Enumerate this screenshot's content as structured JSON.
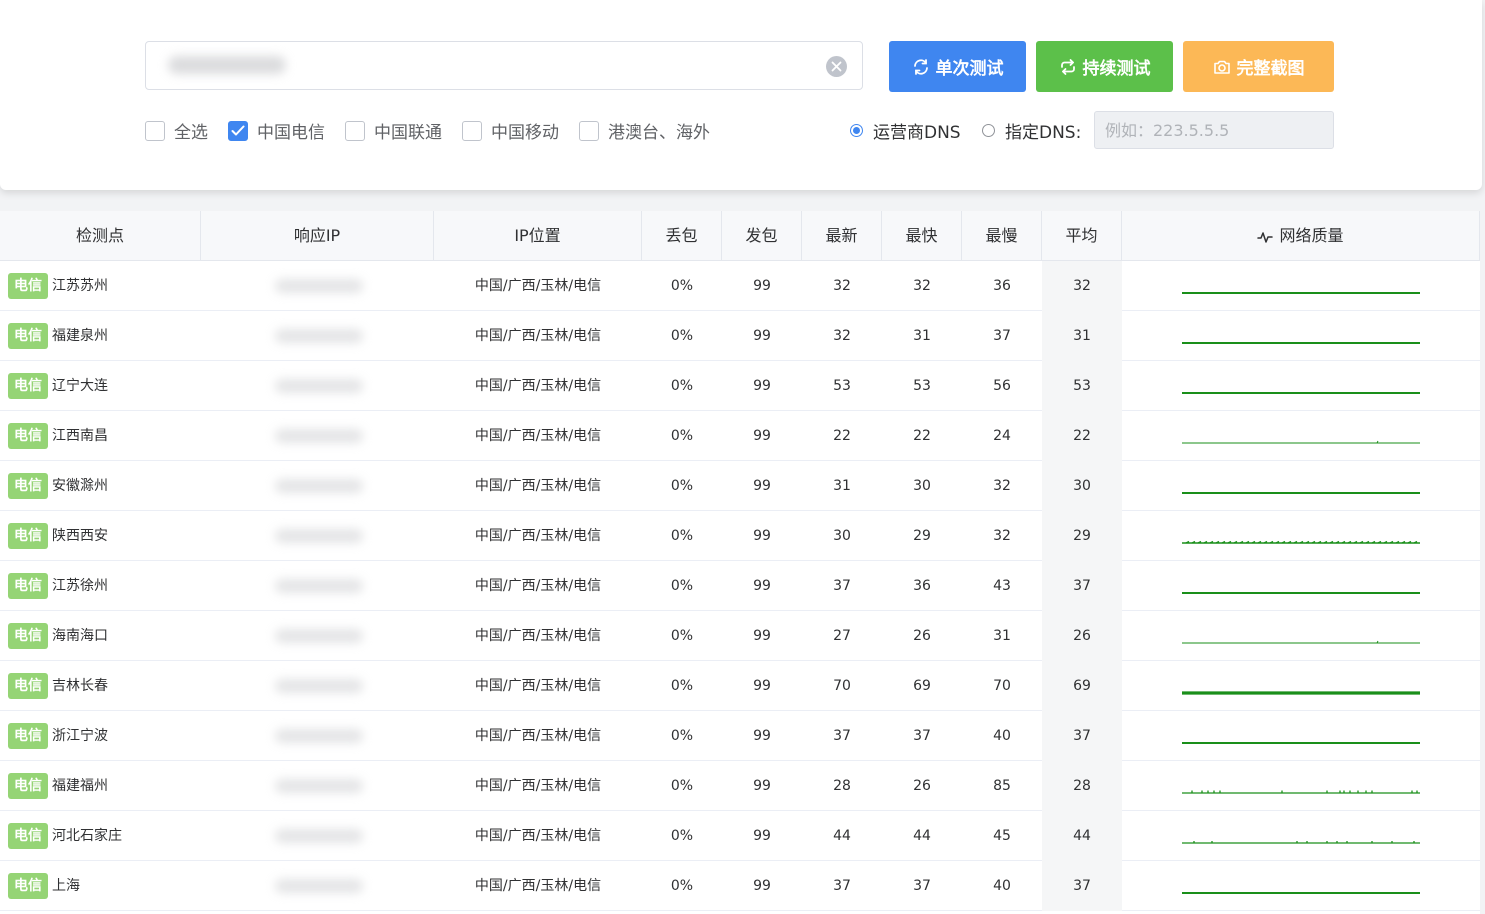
{
  "search": {
    "placeholder": "",
    "value": ""
  },
  "buttons": {
    "single": "单次测试",
    "continuous": "持续测试",
    "screenshot": "完整截图"
  },
  "filters": [
    {
      "label": "全选",
      "checked": false
    },
    {
      "label": "中国电信",
      "checked": true
    },
    {
      "label": "中国联通",
      "checked": false
    },
    {
      "label": "中国移动",
      "checked": false
    },
    {
      "label": "港澳台、海外",
      "checked": false
    }
  ],
  "dns": {
    "carrier_label": "运营商DNS",
    "custom_label": "指定DNS:",
    "custom_placeholder": "例如：223.5.5.5",
    "selected": "carrier"
  },
  "table": {
    "headers": {
      "node": "检测点",
      "ip": "响应IP",
      "location": "IP位置",
      "loss": "丢包",
      "sent": "发包",
      "latest": "最新",
      "fastest": "最快",
      "slowest": "最慢",
      "average": "平均",
      "quality": "网络质量"
    },
    "rows": [
      {
        "isp": "电信",
        "node": "江苏苏州",
        "location": "中国/广西/玉林/电信",
        "loss": "0%",
        "sent": "99",
        "latest": "32",
        "fastest": "32",
        "slowest": "36",
        "average": "32",
        "spark": "flat"
      },
      {
        "isp": "电信",
        "node": "福建泉州",
        "location": "中国/广西/玉林/电信",
        "loss": "0%",
        "sent": "99",
        "latest": "32",
        "fastest": "31",
        "slowest": "37",
        "average": "31",
        "spark": "flat"
      },
      {
        "isp": "电信",
        "node": "辽宁大连",
        "location": "中国/广西/玉林/电信",
        "loss": "0%",
        "sent": "99",
        "latest": "53",
        "fastest": "53",
        "slowest": "56",
        "average": "53",
        "spark": "flat"
      },
      {
        "isp": "电信",
        "node": "江西南昌",
        "location": "中国/广西/玉林/电信",
        "loss": "0%",
        "sent": "99",
        "latest": "22",
        "fastest": "22",
        "slowest": "24",
        "average": "22",
        "spark": "thin"
      },
      {
        "isp": "电信",
        "node": "安徽滁州",
        "location": "中国/广西/玉林/电信",
        "loss": "0%",
        "sent": "99",
        "latest": "31",
        "fastest": "30",
        "slowest": "32",
        "average": "30",
        "spark": "flat"
      },
      {
        "isp": "电信",
        "node": "陕西西安",
        "location": "中国/广西/玉林/电信",
        "loss": "0%",
        "sent": "99",
        "latest": "30",
        "fastest": "29",
        "slowest": "32",
        "average": "29",
        "spark": "noisy"
      },
      {
        "isp": "电信",
        "node": "江苏徐州",
        "location": "中国/广西/玉林/电信",
        "loss": "0%",
        "sent": "99",
        "latest": "37",
        "fastest": "36",
        "slowest": "43",
        "average": "37",
        "spark": "flat"
      },
      {
        "isp": "电信",
        "node": "海南海口",
        "location": "中国/广西/玉林/电信",
        "loss": "0%",
        "sent": "99",
        "latest": "27",
        "fastest": "26",
        "slowest": "31",
        "average": "26",
        "spark": "thin"
      },
      {
        "isp": "电信",
        "node": "吉林长春",
        "location": "中国/广西/玉林/电信",
        "loss": "0%",
        "sent": "99",
        "latest": "70",
        "fastest": "69",
        "slowest": "70",
        "average": "69",
        "spark": "thick"
      },
      {
        "isp": "电信",
        "node": "浙江宁波",
        "location": "中国/广西/玉林/电信",
        "loss": "0%",
        "sent": "99",
        "latest": "37",
        "fastest": "37",
        "slowest": "40",
        "average": "37",
        "spark": "flat"
      },
      {
        "isp": "电信",
        "node": "福建福州",
        "location": "中国/广西/玉林/电信",
        "loss": "0%",
        "sent": "99",
        "latest": "28",
        "fastest": "26",
        "slowest": "85",
        "average": "28",
        "spark": "spiky"
      },
      {
        "isp": "电信",
        "node": "河北石家庄",
        "location": "中国/广西/玉林/电信",
        "loss": "0%",
        "sent": "99",
        "latest": "44",
        "fastest": "44",
        "slowest": "45",
        "average": "44",
        "spark": "dotted"
      },
      {
        "isp": "电信",
        "node": "上海",
        "location": "中国/广西/玉林/电信",
        "loss": "0%",
        "sent": "99",
        "latest": "37",
        "fastest": "37",
        "slowest": "40",
        "average": "37",
        "spark": "flat"
      }
    ]
  },
  "colors": {
    "primary": "#3f86f0",
    "success": "#5cc04a",
    "warning": "#fcb856",
    "isp_tag": "#95d475",
    "sparkline": "#1a8f1a"
  },
  "icons": {
    "clear": "circle-close-icon",
    "single": "refresh-icon",
    "continuous": "loop-icon",
    "screenshot": "camera-icon",
    "quality": "pulse-icon"
  }
}
